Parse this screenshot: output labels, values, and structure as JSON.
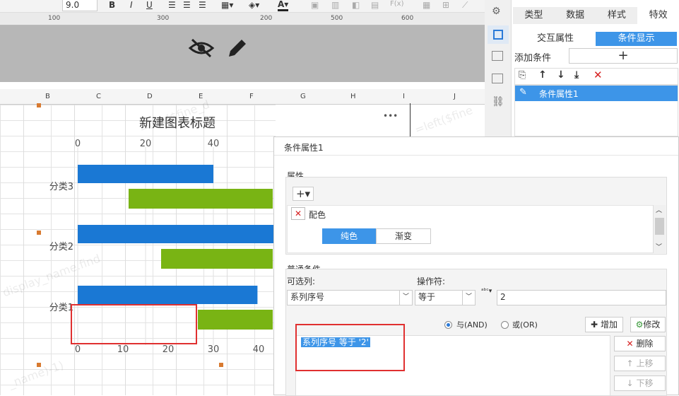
{
  "toolbar": {
    "font_size": "9.0",
    "bold": "B",
    "italic": "I",
    "underline": "U"
  },
  "ruler": {
    "marks": [
      "100",
      "200",
      "300",
      "400",
      "500",
      "600"
    ]
  },
  "columns": [
    "B",
    "C",
    "D",
    "E",
    "F",
    "G",
    "H",
    "I",
    "J"
  ],
  "chart_data": {
    "type": "bar",
    "title": "新建图表标题",
    "categories": [
      "分类3",
      "分类2",
      "分类1"
    ],
    "series": [
      {
        "values": [
          40,
          58,
          53
        ]
      },
      {
        "values": [
          57,
          63,
          57
        ]
      }
    ],
    "top_ticks": [
      "0",
      "20",
      "40"
    ],
    "bottom_ticks": [
      "0",
      "10",
      "20",
      "30",
      "40"
    ],
    "more_label": "•••"
  },
  "right_tabs": [
    {
      "label": "类型"
    },
    {
      "label": "数据"
    },
    {
      "label": "样式"
    },
    {
      "label": "特效"
    }
  ],
  "sub_tabs": {
    "interactive": "交互属性",
    "condition": "条件显示"
  },
  "add_condition": {
    "label": "添加条件",
    "plus": "+"
  },
  "cond_list": {
    "item": "条件属性1"
  },
  "dialog": {
    "title": "条件属性1",
    "attr_section": "属性",
    "plus_select": "+▾",
    "color_attr": "配色",
    "solid": "纯色",
    "gradient": "渐变",
    "common_cond": "普通条件",
    "column_label": "可选列:",
    "column_value": "系列序号",
    "operator_label": "操作符:",
    "operator_value": "等于",
    "value": "2",
    "and_label": "与(AND)",
    "or_label": "或(OR)",
    "add_btn": "增加",
    "modify_btn": "修改",
    "delete_btn": "删除",
    "up_btn": "上移",
    "down_btn": "下移",
    "condition_text": "系列序号 等于 '2'"
  }
}
